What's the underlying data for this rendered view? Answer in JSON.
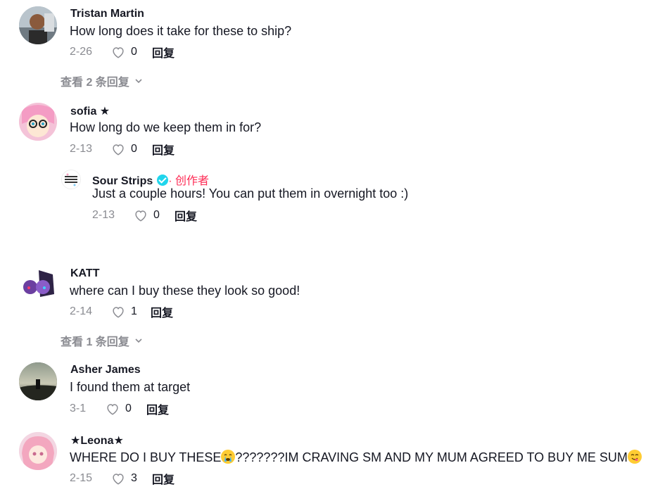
{
  "comments": [
    {
      "username": "Tristan Martin",
      "text": "How long does it take for these to ship?",
      "date": "2-26",
      "likes": "0",
      "reply": "回复",
      "view_replies": "查看 2 条回复"
    },
    {
      "username": "sofia ★",
      "text": "How long do we keep them in for?",
      "date": "2-13",
      "likes": "0",
      "reply": "回复",
      "reply_item": {
        "username": "Sour Strips",
        "creator_label": "· 创作者",
        "text": "Just a couple hours! You can put them in overnight too :)",
        "date": "2-13",
        "likes": "0",
        "reply": "回复"
      }
    },
    {
      "username": "KATT",
      "text": "where can I buy these they look so good!",
      "date": "2-14",
      "likes": "1",
      "reply": "回复",
      "view_replies": "查看 1 条回复"
    },
    {
      "username": "Asher James",
      "text": "I found them at target",
      "date": "3-1",
      "likes": "0",
      "reply": "回复"
    },
    {
      "username": "★Leona★",
      "text_part1": "WHERE DO I BUY THESE",
      "text_part2": "???????IM CRAVING SM AND MY MUM AGREED TO BUY ME SUM",
      "date": "2-15",
      "likes": "3",
      "reply": "回复"
    }
  ],
  "icons": {
    "like": "heart-outline-icon",
    "expand": "chevron-down-icon",
    "verified": "verified-badge-icon"
  },
  "colors": {
    "accent": "#fe2c55",
    "verified": "#20d5ec",
    "muted": "#8a8b91"
  }
}
